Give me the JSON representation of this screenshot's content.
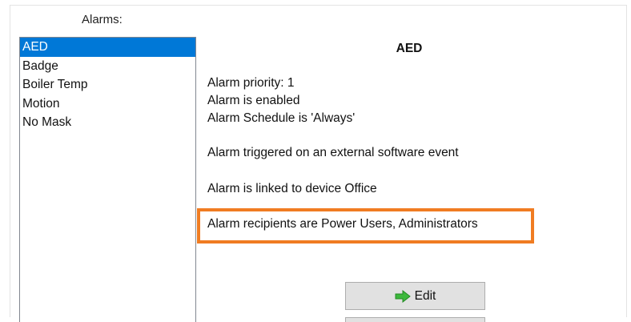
{
  "window": {
    "alarms_label": "Alarms:"
  },
  "alarm_list": {
    "items": [
      {
        "label": "AED",
        "selected": true
      },
      {
        "label": "Badge",
        "selected": false
      },
      {
        "label": "Boiler Temp",
        "selected": false
      },
      {
        "label": "Motion",
        "selected": false
      },
      {
        "label": "No Mask",
        "selected": false
      }
    ]
  },
  "details": {
    "title": "AED",
    "priority": "Alarm priority: 1",
    "enabled": "Alarm is enabled",
    "schedule": "Alarm Schedule is 'Always'",
    "trigger": "Alarm triggered on an external software event",
    "linked_device": "Alarm is linked to device Office",
    "recipients": "Alarm recipients are Power Users, Administrators"
  },
  "buttons": {
    "edit_label": "Edit",
    "edit_icon": "green-right-arrow-icon"
  },
  "colors": {
    "selection": "#0078d7",
    "highlight": "#f07c22",
    "edit_icon": "#3cb83c"
  }
}
